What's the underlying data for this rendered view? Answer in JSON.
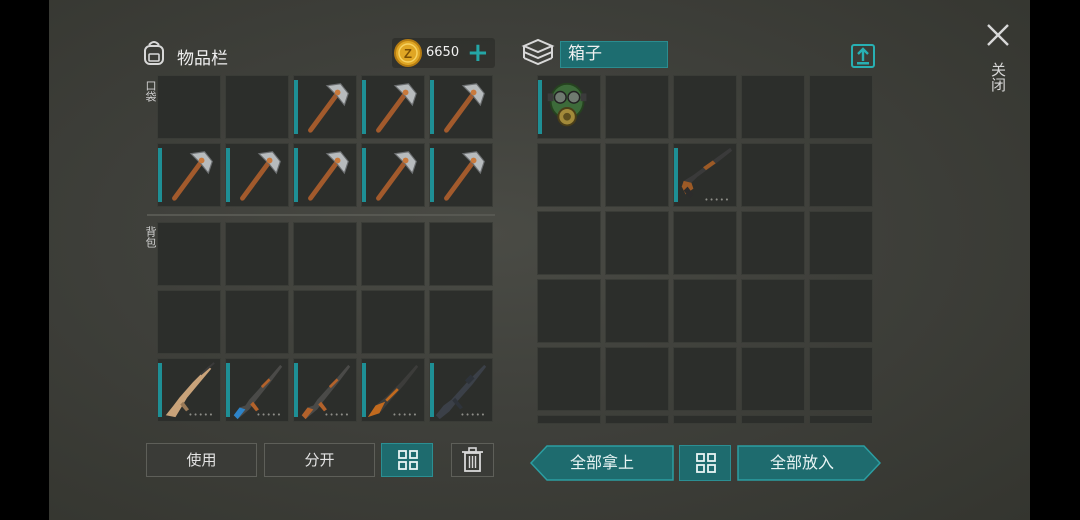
{
  "inventory": {
    "title": "物品栏",
    "coins": "6650",
    "pocket_label": "口袋",
    "backpack_label": "背包"
  },
  "container": {
    "name": "箱子"
  },
  "close_label": "关闭",
  "buttons": {
    "use": "使用",
    "split": "分开",
    "take_all": "全部拿上",
    "put_all": "全部放入"
  },
  "colors": {
    "accent": "#1e8f95",
    "panel_bg": "#3f403b",
    "slot_bg": "#2c2e2b"
  },
  "items": {
    "pocket_row1": [
      "",
      "",
      "pickaxe",
      "pickaxe",
      "pickaxe"
    ],
    "pocket_row2": [
      "pickaxe",
      "pickaxe",
      "pickaxe",
      "pickaxe",
      "pickaxe"
    ],
    "backpack_row3": [
      "scar-rifle-icon",
      "ak-rifle-blue-icon",
      "ak-rifle-icon",
      "sks-rifle-icon",
      "m16-rifle-icon"
    ],
    "box_items": [
      "gas-mask-icon",
      "shotgun-icon"
    ]
  }
}
